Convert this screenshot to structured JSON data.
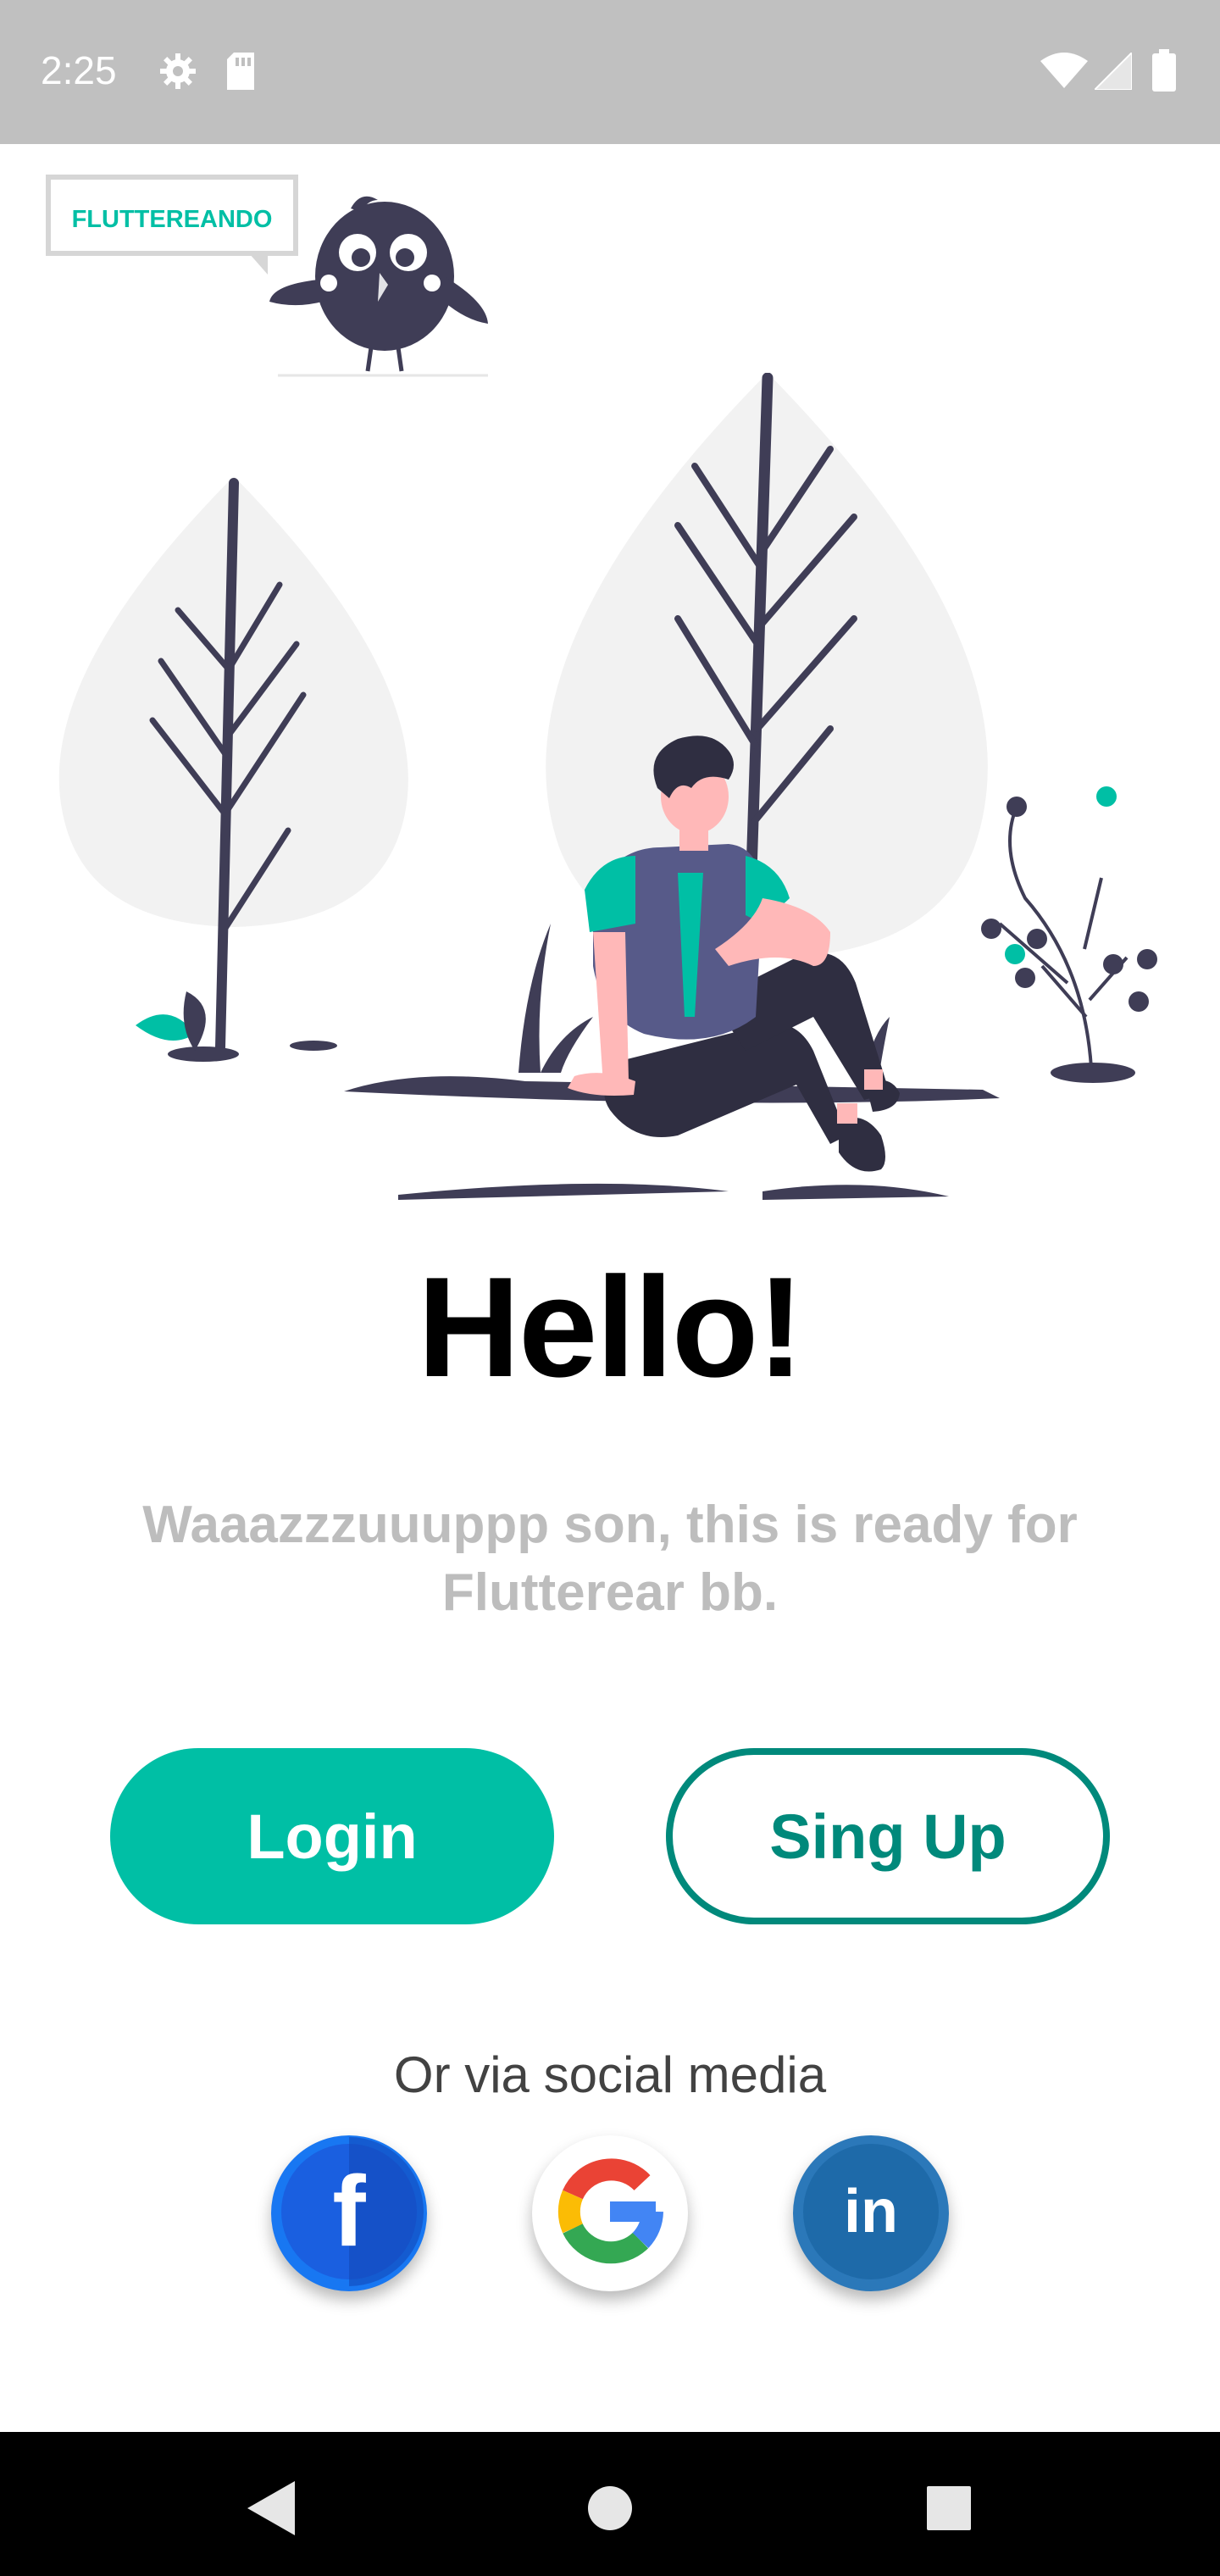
{
  "status_bar": {
    "time": "2:25",
    "left_icons": [
      "settings-icon",
      "sd-card-icon"
    ],
    "right_icons": [
      "wifi-icon",
      "signal-icon",
      "battery-icon"
    ]
  },
  "app": {
    "logo_text": "FLUTTEREANDO",
    "title": "Hello!",
    "subtitle": "Waaazzzuuuppp son, this is ready for Flutterear bb.",
    "login_label": "Login",
    "signup_label": "Sing Up",
    "social_caption": "Or via social media",
    "social": [
      {
        "name": "facebook",
        "icon": "facebook-icon",
        "glyph": "f",
        "color": "#1877f2"
      },
      {
        "name": "google",
        "icon": "google-icon",
        "glyph": "G",
        "color": "#ffffff"
      },
      {
        "name": "linkedin",
        "icon": "linkedin-icon",
        "glyph": "in",
        "color": "#2b78b9"
      }
    ]
  },
  "colors": {
    "accent": "#00bfa5",
    "accent_dark": "#00897b",
    "subtitle": "#bdbdbd",
    "illustration_dark": "#3f3d56",
    "illustration_light": "#f2f2f2"
  },
  "nav_bar": {
    "buttons": [
      "back-icon",
      "home-icon",
      "recents-icon"
    ]
  }
}
